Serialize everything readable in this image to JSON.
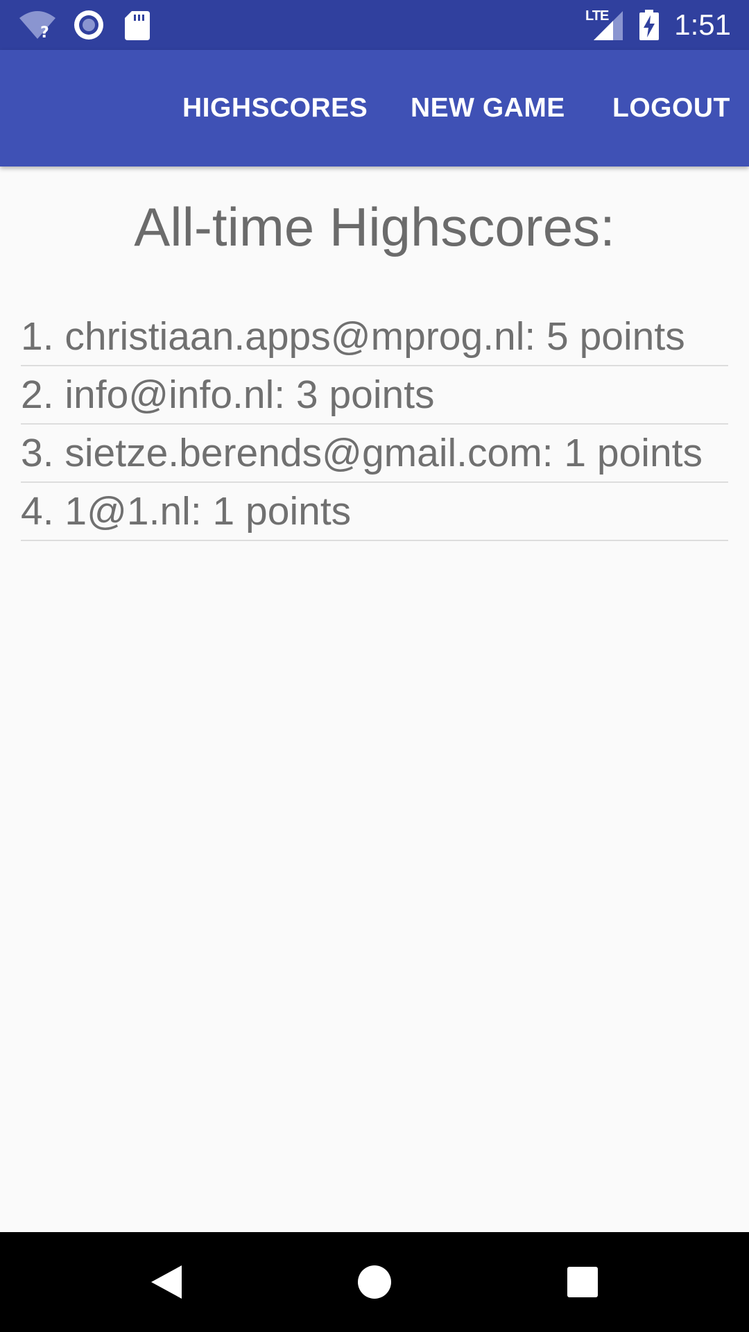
{
  "status_bar": {
    "time": "1:51",
    "network_label": "LTE",
    "icons": [
      "wifi-unknown-icon",
      "sync-circle-icon",
      "sd-card-icon",
      "lte-signal-icon",
      "battery-charging-icon"
    ]
  },
  "app_bar": {
    "menu": [
      {
        "label": "HIGHSCORES"
      },
      {
        "label": "NEW GAME"
      },
      {
        "label": "LOGOUT"
      }
    ],
    "background_color": "#3f51b5",
    "status_color": "#30409e"
  },
  "main": {
    "title": "All-time Highscores:",
    "scores": [
      "1. christiaan.apps@mprog.nl: 5 points",
      "2. info@info.nl: 3 points",
      "3. sietze.berends@gmail.com: 1 points",
      "4. 1@1.nl: 1 points"
    ]
  },
  "nav_bar": {
    "icons": [
      "back-icon",
      "home-icon",
      "recents-icon"
    ]
  }
}
